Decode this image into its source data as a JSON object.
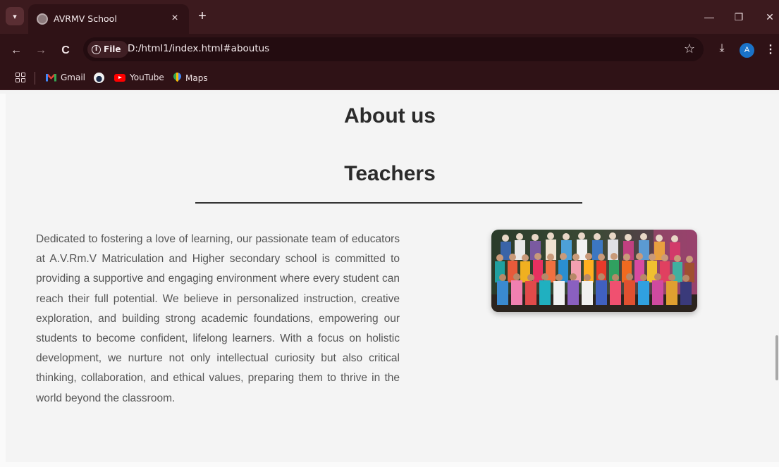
{
  "browser": {
    "tab": {
      "title": "AVRMV School",
      "close": "×"
    },
    "new_tab": "+",
    "window_controls": {
      "minimize": "—",
      "restore": "❐",
      "close": "✕"
    },
    "nav": {
      "back": "←",
      "forward": "→",
      "reload": "C"
    },
    "omnibox": {
      "chip_label": "File",
      "url": "D:/html1/index.html#aboutus"
    },
    "profile_initial": "A",
    "bookmarks": [
      {
        "label": "Gmail",
        "icon": "gmail-icon"
      },
      {
        "label": "",
        "icon": "edge-icon"
      },
      {
        "label": "YouTube",
        "icon": "youtube-icon"
      },
      {
        "label": "Maps",
        "icon": "maps-icon"
      }
    ],
    "colors": {
      "frame": "#3c1a1e",
      "toolbar": "#2f1216",
      "page_bg": "#f4f4f4"
    }
  },
  "page": {
    "about_heading": "About us",
    "teachers_heading": "Teachers",
    "teachers_paragraph": "Dedicated to fostering a love of learning, our passionate team of educators at A.V.Rm.V Matriculation and Higher secondary school is committed to providing a supportive and engaging environment where every student can reach their full potential. We believe in personalized instruction, creative exploration, and building strong academic foundations, empowering our students to become confident, lifelong learners. With a focus on holistic development, we nurture not only intellectual curiosity but also critical thinking, collaboration, and ethical values, preparing them to thrive in the world beyond the classroom.",
    "photo_icon": "teachers-group-photo"
  }
}
